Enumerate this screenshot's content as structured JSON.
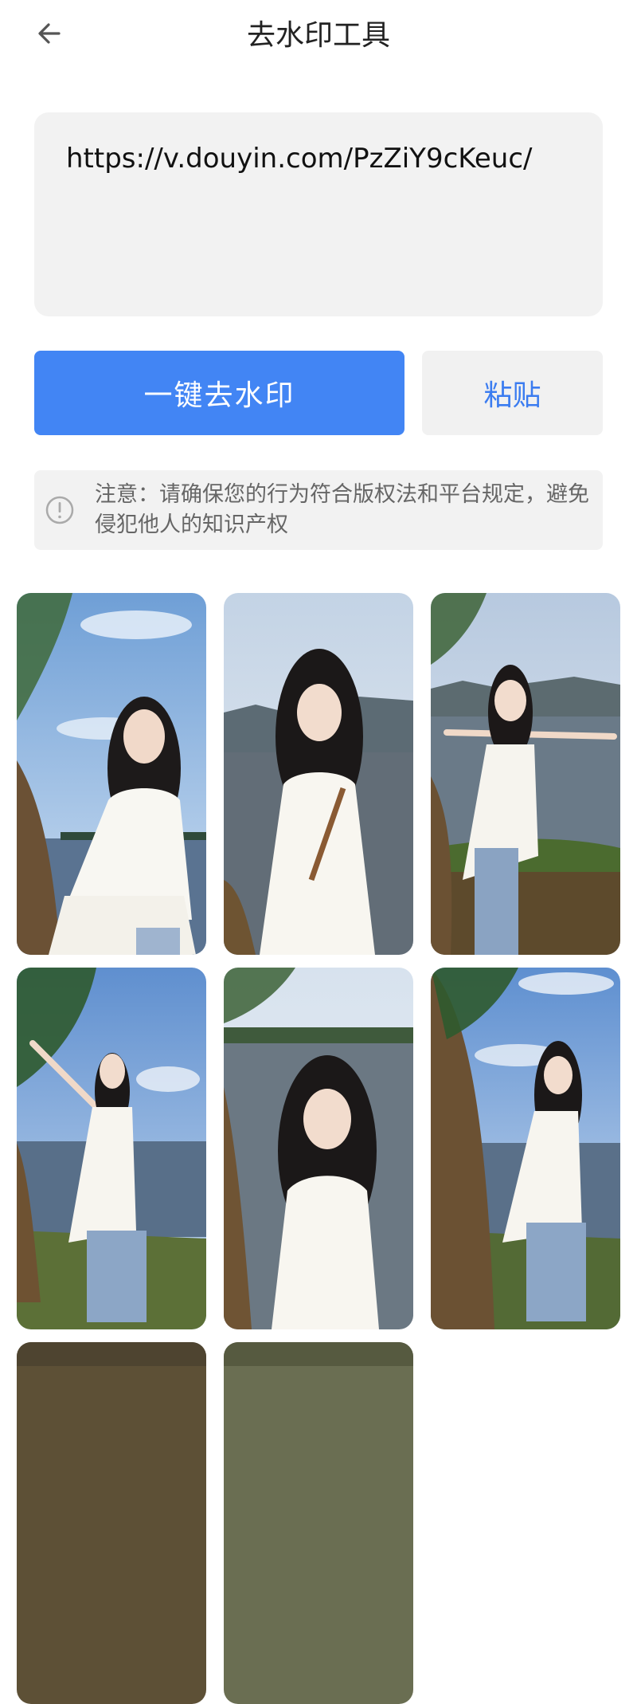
{
  "header": {
    "title": "去水印工具"
  },
  "url_input": {
    "value": "https://v.douyin.com/PzZiY9cKeuc/"
  },
  "actions": {
    "primary_label": "一键去水印",
    "paste_label": "粘贴"
  },
  "notice": {
    "text": "注意：请确保您的行为符合版权法和平台规定，避免侵犯他人的知识产权"
  },
  "icons": {
    "back": "arrow-left-icon",
    "notice": "exclamation-circle-icon"
  },
  "colors": {
    "primary": "#4285f4",
    "paste_text": "#3b7cf0",
    "panel_bg": "#f2f2f2"
  }
}
